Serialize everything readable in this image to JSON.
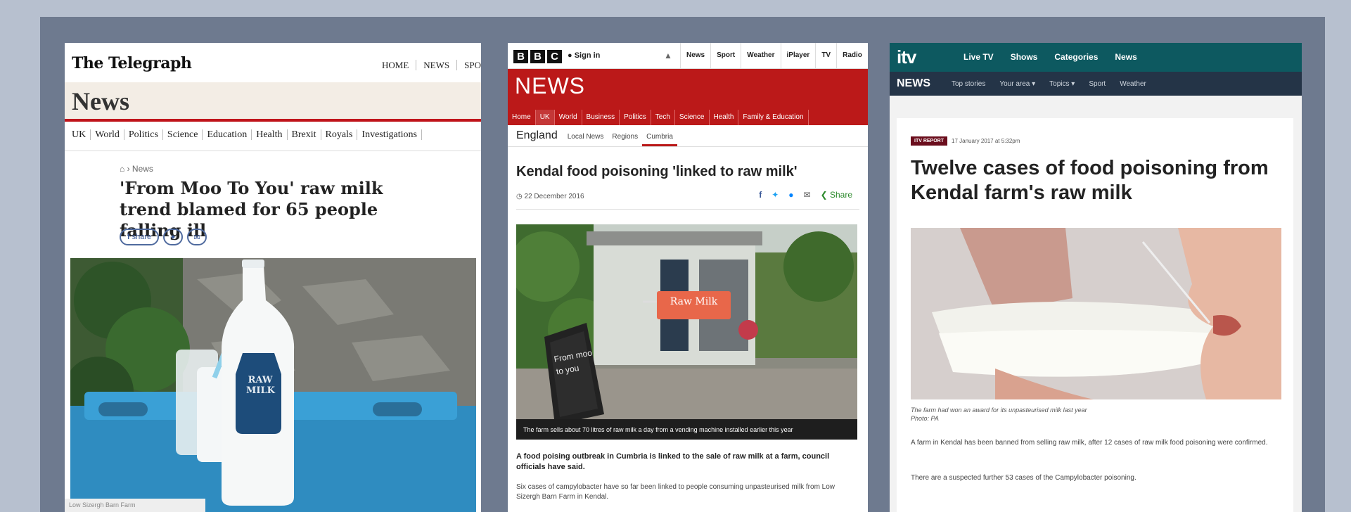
{
  "telegraph": {
    "logo": "The Telegraph",
    "top_nav": [
      "HOME",
      "NEWS",
      "SPO"
    ],
    "section_title": "News",
    "sub_nav": [
      "UK",
      "World",
      "Politics",
      "Science",
      "Education",
      "Health",
      "Brexit",
      "Royals",
      "Investigations"
    ],
    "breadcrumb": "News",
    "headline": "'From Moo To You' raw milk trend blamed for 65 people falling ill",
    "share_label": "share",
    "photo_label_line1": "RAW",
    "photo_label_line2": "MILK",
    "caption": "Low Sizergh Barn Farm"
  },
  "bbc": {
    "logo_letters": [
      "B",
      "B",
      "C"
    ],
    "sign_in": "Sign in",
    "top_links": [
      "News",
      "Sport",
      "Weather",
      "iPlayer",
      "TV",
      "Radio"
    ],
    "brand": "NEWS",
    "red_nav": [
      "Home",
      "UK",
      "World",
      "Business",
      "Politics",
      "Tech",
      "Science",
      "Health",
      "Family & Education"
    ],
    "section_nav": [
      "England",
      "Local News",
      "Regions",
      "Cumbria"
    ],
    "headline": "Kendal food poisoning 'linked to raw milk'",
    "date": "22 December 2016",
    "share_label": "Share",
    "photo_sign": "Raw Milk",
    "board_line1": "From moo",
    "board_line2": "to you",
    "caption": "The farm sells about 70 litres of raw milk a day from a vending machine installed earlier this year",
    "lead": "A food poising outbreak in Cumbria is linked to the sale of raw milk at a farm, council officials have said.",
    "para": "Six cases of campylobacter have so far been linked to people consuming unpasteurised milk from Low Sizergh Barn Farm in Kendal."
  },
  "itv": {
    "logo": "itv",
    "top_links": [
      "Live TV",
      "Shows",
      "Categories",
      "News"
    ],
    "nav_brand": "NEWS",
    "nav_links": [
      "Top stories",
      "Your area ▾",
      "Topics ▾",
      "Sport",
      "Weather"
    ],
    "badge": "ITV REPORT",
    "date": "17 January 2017 at 5:32pm",
    "headline": "Twelve cases of food poisoning from Kendal farm's raw milk",
    "caption_line1": "The farm had won an award for its unpasteurised milk last year",
    "caption_line2": "Photo: PA",
    "para1": "A farm in Kendal has been banned from selling raw milk, after 12 cases of raw milk food poisoning were confirmed.",
    "para2": "There are a suspected further 53 cases of the Campylobacter poisoning."
  }
}
